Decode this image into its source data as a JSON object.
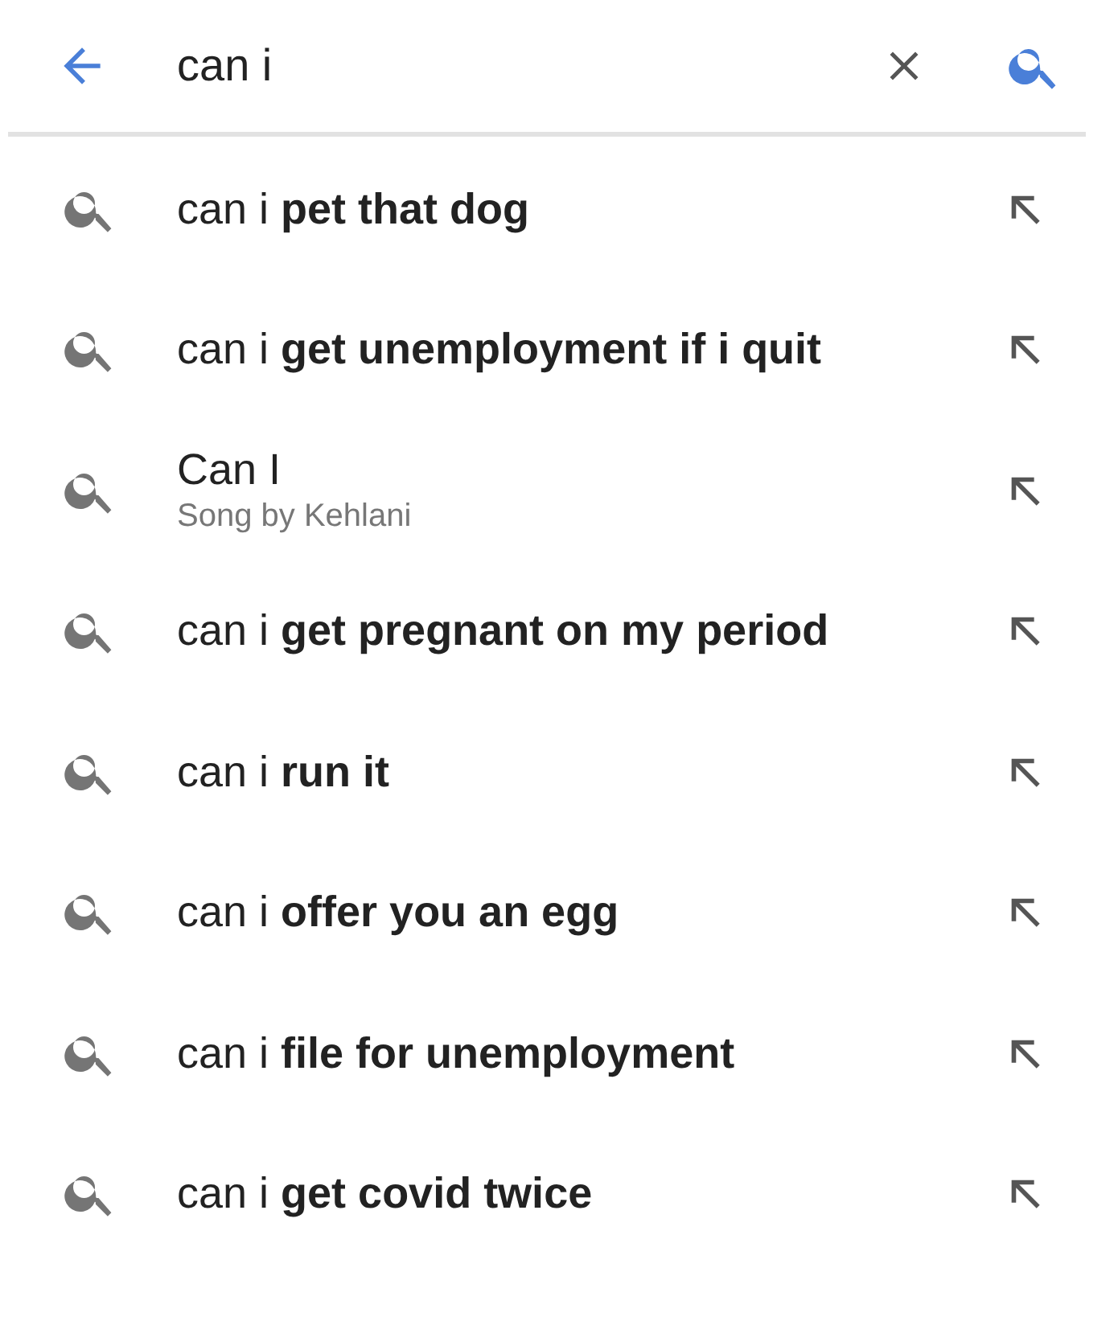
{
  "search_bar": {
    "value": "can i"
  },
  "suggestions": [
    {
      "kind": "query",
      "text": "can i **pet that dog**"
    },
    {
      "kind": "query",
      "text": "can i **get unemployment if i quit**"
    },
    {
      "kind": "entity",
      "text": "Can I",
      "subtitle": "Song by Kehlani"
    },
    {
      "kind": "query",
      "text": "can i **get pregnant on my period**"
    },
    {
      "kind": "query",
      "text": "can i **run it**"
    },
    {
      "kind": "query",
      "text": "can i **offer you an egg**"
    },
    {
      "kind": "query",
      "text": "can i **file for unemployment**"
    },
    {
      "kind": "query",
      "text": "can i **get covid twice**"
    }
  ]
}
